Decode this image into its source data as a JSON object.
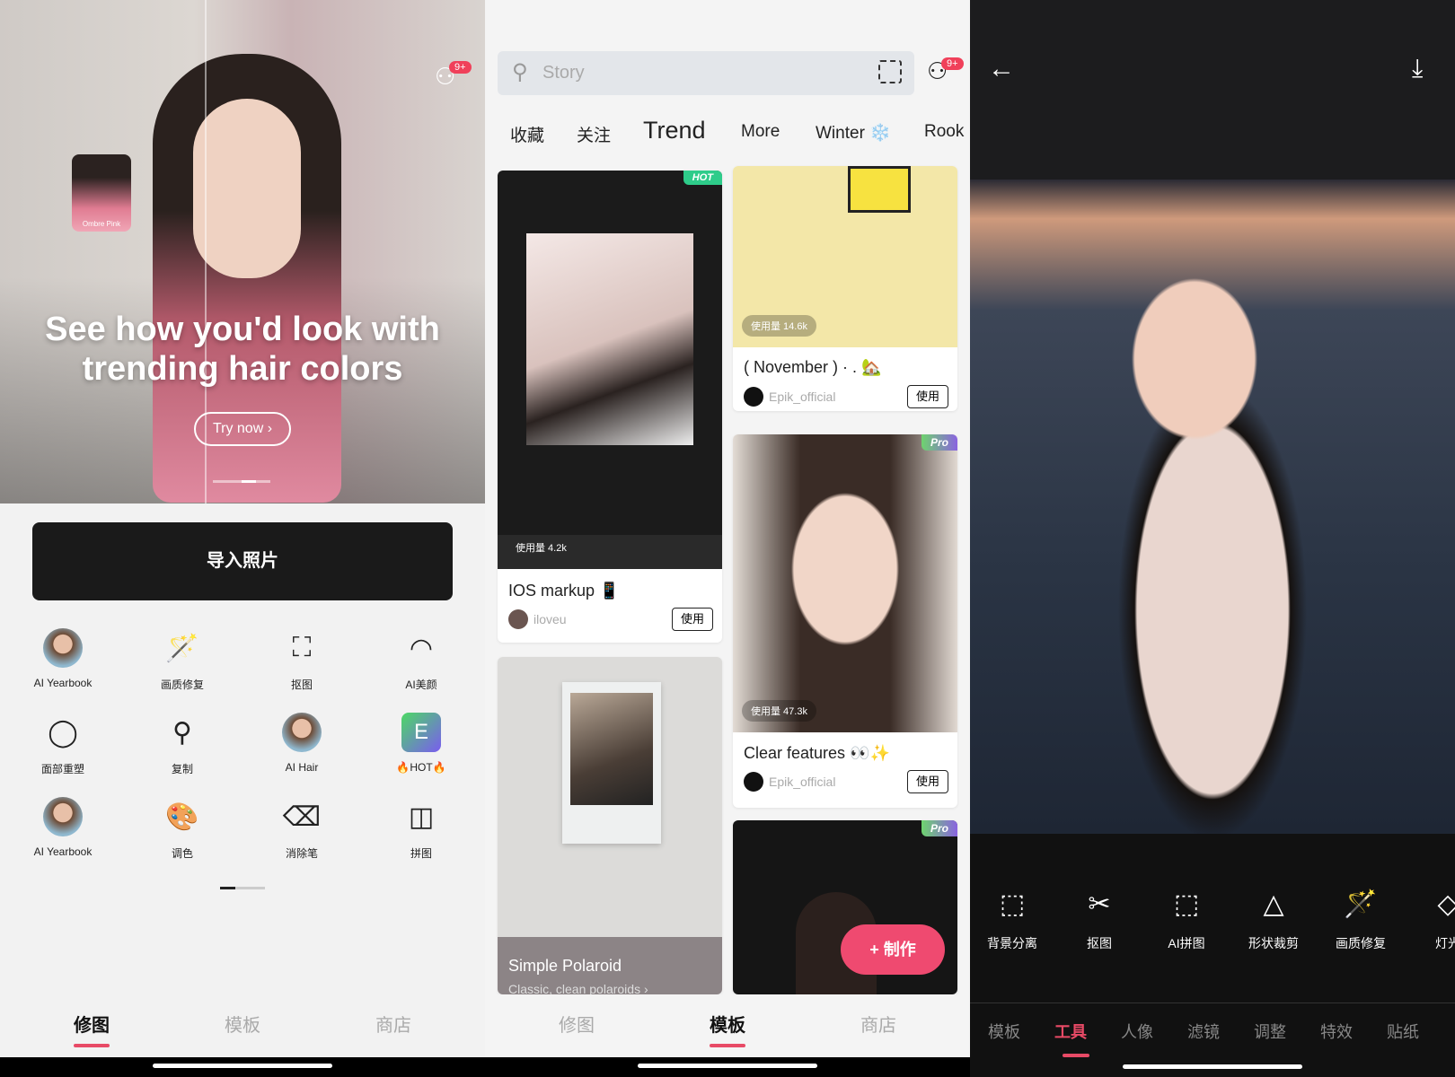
{
  "colors": {
    "accent": "#e84a66",
    "badge": "#f0405a",
    "hot_tag": "#2ecc8a"
  },
  "edit_home": {
    "notification_badge": "9+",
    "hero_thumb_label": "Ombre Pink",
    "hero_title": "See how you'd look with trending hair colors",
    "try_now": "Try now ›",
    "import_button": "导入照片",
    "tools": [
      {
        "label": "AI Yearbook",
        "icon": "avatar"
      },
      {
        "label": "画质修复",
        "icon": "magic-wand-icon"
      },
      {
        "label": "抠图",
        "icon": "ai-cutout-icon"
      },
      {
        "label": "AI美颜",
        "icon": "ai-beauty-icon"
      },
      {
        "label": "面部重塑",
        "icon": "face-reshape-icon"
      },
      {
        "label": "复制",
        "icon": "clone-icon"
      },
      {
        "label": "AI Hair",
        "icon": "avatar"
      },
      {
        "label": "🔥HOT🔥",
        "icon": "app-icon"
      },
      {
        "label": "AI Yearbook",
        "icon": "avatar"
      },
      {
        "label": "调色",
        "icon": "palette-icon"
      },
      {
        "label": "消除笔",
        "icon": "eraser-icon"
      },
      {
        "label": "拼图",
        "icon": "collage-icon"
      }
    ]
  },
  "nav": {
    "items": [
      "修图",
      "模板",
      "商店"
    ]
  },
  "templates": {
    "search_placeholder": "Story",
    "notification_badge": "9+",
    "tabs": [
      "收藏",
      "关注",
      "Trend",
      "More",
      "Winter ❄️",
      "Rook"
    ],
    "use_label": "使用",
    "cards": [
      {
        "tag": "HOT",
        "count": "使用量 4.2k",
        "title": "IOS markup 📱",
        "author": "iloveu"
      },
      {
        "count": "使用量 14.6k",
        "title": "( November ) · . 🏡",
        "author": "Epik_official"
      },
      {
        "tag": "Pro",
        "count": "使用量 47.3k",
        "title": "Clear features 👀✨",
        "author": "Epik_official"
      },
      {
        "title": "Simple Polaroid",
        "subtitle": "Classic, clean polaroids ›"
      },
      {
        "tag": "Pro"
      }
    ],
    "fab": "+  制作"
  },
  "editor": {
    "tools": [
      "背景分离",
      "抠图",
      "AI拼图",
      "形状裁剪",
      "画质修复",
      "灯光"
    ],
    "tabs": [
      "模板",
      "工具",
      "人像",
      "滤镜",
      "调整",
      "特效",
      "贴纸"
    ],
    "active_tab": "工具"
  }
}
